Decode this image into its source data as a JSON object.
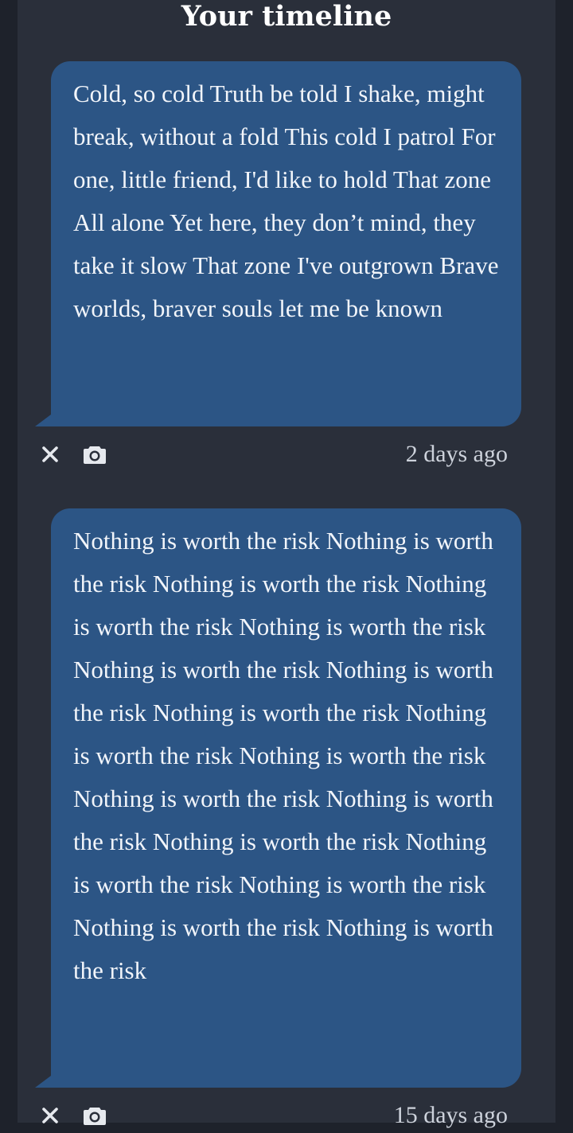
{
  "page": {
    "title": "Your timeline"
  },
  "colors": {
    "background": "#1e222b",
    "panel": "#2a2f3a",
    "bubble": "#2c5585",
    "text": "#f2f5fa",
    "meta_text": "#cdd2db"
  },
  "posts": [
    {
      "text": "Cold, so cold Truth be told I shake, might break, without a fold This cold I patrol For one, little friend, I'd like to hold That zone All alone Yet here, they don’t mind, they take it slow That zone I've outgrown Brave worlds, braver souls let me be known",
      "time": "2 days ago",
      "actions": [
        "close-icon",
        "camera-icon"
      ]
    },
    {
      "text": "Nothing is worth the risk Nothing is worth the risk Nothing is worth the risk Nothing is worth the risk Nothing is worth the risk Nothing is worth the risk Nothing is worth the risk Nothing is worth the risk Nothing is worth the risk Nothing is worth the risk Nothing is worth the risk Nothing is worth the risk Nothing is worth the risk Nothing is worth the risk Nothing is worth the risk Nothing is worth the risk Nothing is worth the risk",
      "time": "15 days ago",
      "actions": [
        "close-icon",
        "camera-icon"
      ]
    }
  ]
}
